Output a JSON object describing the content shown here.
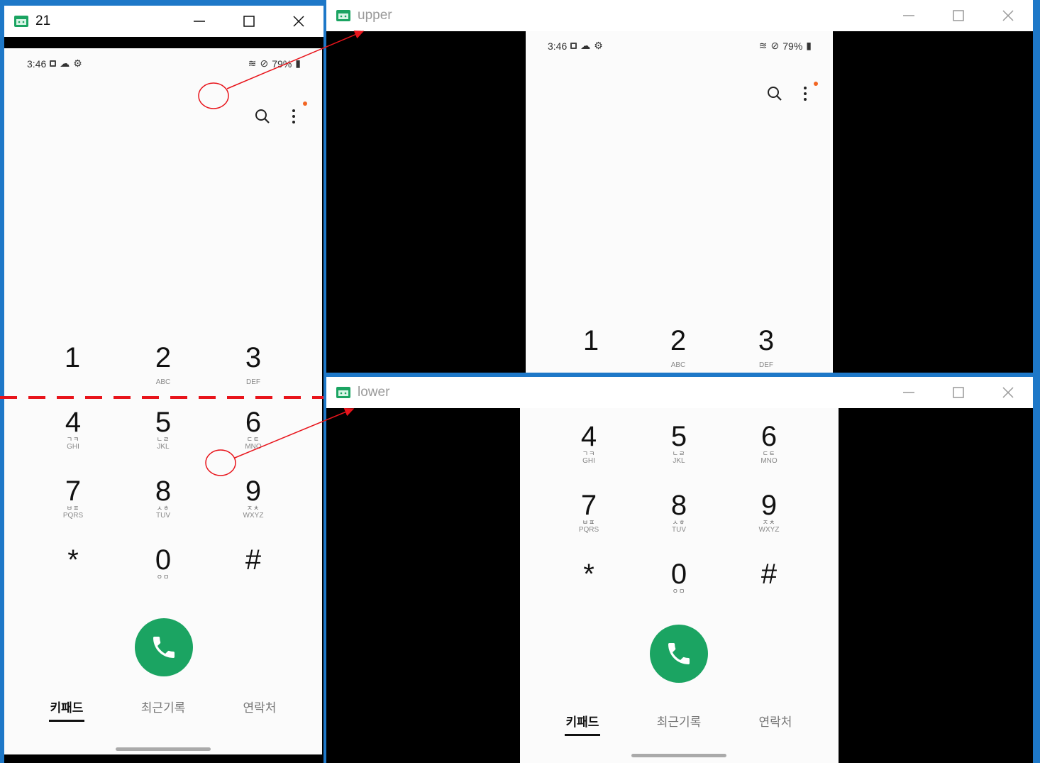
{
  "windows": {
    "main": {
      "title": "21"
    },
    "upper": {
      "title": "upper"
    },
    "lower": {
      "title": "lower"
    }
  },
  "status_bar": {
    "time": "3:46",
    "battery": "79%"
  },
  "keypad": [
    {
      "num": "1",
      "kor": "",
      "lat": ""
    },
    {
      "num": "2",
      "kor": "",
      "lat": "ABC"
    },
    {
      "num": "3",
      "kor": "",
      "lat": "DEF"
    },
    {
      "num": "4",
      "kor": "ㄱㅋ",
      "lat": "GHI"
    },
    {
      "num": "5",
      "kor": "ㄴㄹ",
      "lat": "JKL"
    },
    {
      "num": "6",
      "kor": "ㄷㅌ",
      "lat": "MNO"
    },
    {
      "num": "7",
      "kor": "ㅂㅍ",
      "lat": "PQRS"
    },
    {
      "num": "8",
      "kor": "ㅅㅎ",
      "lat": "TUV"
    },
    {
      "num": "9",
      "kor": "ㅈㅊ",
      "lat": "WXYZ"
    },
    {
      "num": "*",
      "kor": "",
      "lat": ""
    },
    {
      "num": "0",
      "kor": "ㅇㅁ",
      "lat": ""
    },
    {
      "num": "#",
      "kor": "",
      "lat": ""
    }
  ],
  "tabs": [
    {
      "label": "키패드",
      "active": true
    },
    {
      "label": "최근기록",
      "active": false
    },
    {
      "label": "연락처",
      "active": false
    }
  ],
  "colors": {
    "call": "#1ba462",
    "annotation": "#e8141b",
    "notify_dot": "#f26522",
    "desktop": "#1e78c8"
  },
  "icons": [
    "app-icon",
    "minimize-icon",
    "maximize-icon",
    "close-icon",
    "search-icon",
    "more-vert-icon",
    "phone-icon",
    "wifi-icon",
    "cloud-icon",
    "gear-icon",
    "battery-icon"
  ]
}
